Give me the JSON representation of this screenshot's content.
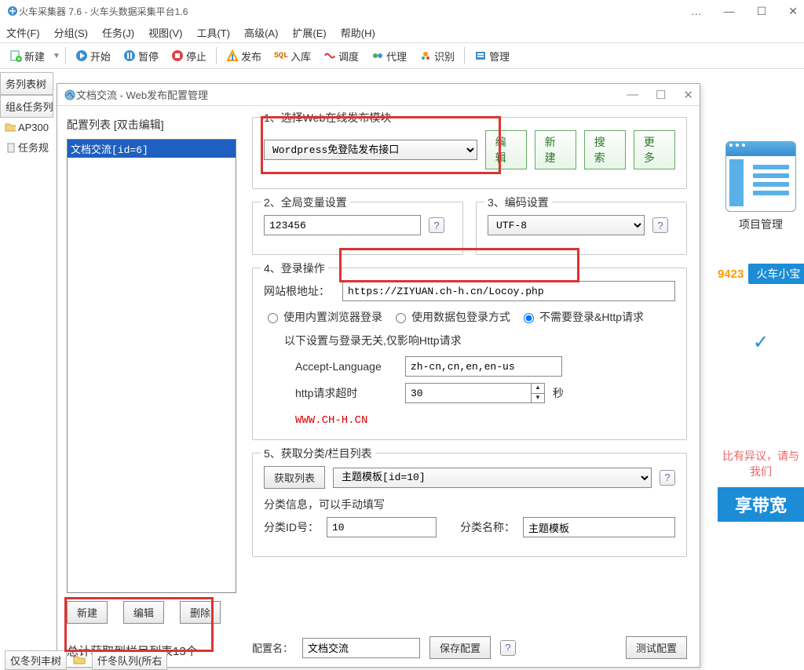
{
  "mainWindow": {
    "title": "火车采集器 7.6 - 火车头数据采集平台1.6",
    "winBtns": {
      "dots": "…",
      "min": "—",
      "max": "☐",
      "close": "✕"
    }
  },
  "menu": {
    "file": "文件(F)",
    "group": "分组(S)",
    "task": "任务(J)",
    "view": "视图(V)",
    "tool": "工具(T)",
    "advanced": "高级(A)",
    "ext": "扩展(E)",
    "help": "帮助(H)"
  },
  "toolbar": {
    "new": "新建",
    "start": "开始",
    "pause": "暂停",
    "stop": "停止",
    "publish": "发布",
    "import": "入库",
    "schedule": "调度",
    "proxy": "代理",
    "detect": "识别",
    "manage": "管理"
  },
  "side": {
    "tabMain": "务列表树",
    "tabGroup": "组&任务列",
    "ap300": "AP300",
    "taskRule": "任务规"
  },
  "dialog": {
    "title": "文档交流 - Web发布配置管理",
    "cfgListLabel": "配置列表  [双击编辑]",
    "cfgItem": "文档交流[id=6]",
    "leftBtns": {
      "new": "新建",
      "edit": "编辑",
      "del": "删除"
    },
    "section1": {
      "label": "1、选择Web在线发布模块",
      "module": "Wordpress免登陆发布接口",
      "btns": {
        "edit": "编辑",
        "new": "新建",
        "search": "搜索",
        "more": "更多"
      }
    },
    "section2": {
      "label": "2、全局变量设置",
      "value": "123456"
    },
    "section3": {
      "label": "3、编码设置",
      "encoding": "UTF-8"
    },
    "section4": {
      "label": "4、登录操作",
      "rootLabel": "网站根地址：",
      "rootValue": "https://ZIYUAN.ch-h.cn/Locoy.php",
      "opt1": "使用内置浏览器登录",
      "opt2": "使用数据包登录方式",
      "opt3": "不需要登录&Http请求",
      "note": "以下设置与登录无关,仅影响Http请求",
      "acceptLang": "Accept-Language",
      "acceptLangVal": "zh-cn,cn,en,en-us",
      "timeout": "http请求超时",
      "timeoutVal": "30",
      "sec": "秒",
      "url": "WWW.CH-H.CN"
    },
    "section5": {
      "label": "5、获取分类/栏目列表",
      "getBtn": "获取列表",
      "template": "主题模板[id=10]",
      "infoLabel": "分类信息，可以手动填写",
      "idLabel": "分类ID号：",
      "idVal": "10",
      "nameLabel": "分类名称：",
      "nameVal": "主题模板"
    },
    "bottom": {
      "cfgName": "配置名：",
      "cfgVal": "文档交流",
      "save": "保存配置",
      "test": "测试配置"
    },
    "total": "总计获取到栏目列表13个"
  },
  "right": {
    "projLabel": "项目管理",
    "orange": "9423",
    "pill": "火车小宝",
    "alert": "比有异议，请与我们",
    "banner": "享带宽"
  },
  "footer": {
    "t1": "仅冬列丰树",
    "t2": "仟冬队列(所右"
  }
}
